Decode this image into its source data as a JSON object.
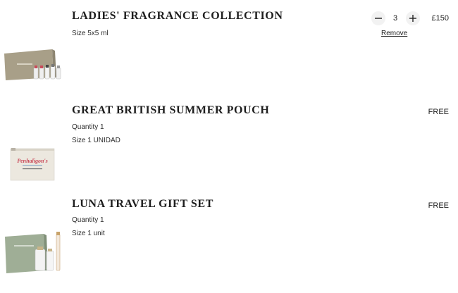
{
  "items": [
    {
      "title": "LADIES' FRAGRANCE COLLECTION",
      "size_label": "Size 5x5 ml",
      "quantity": "3",
      "price": "£150",
      "remove_label": "Remove",
      "image_icon": "fragrance-collection-box-image"
    },
    {
      "title": "GREAT BRITISH SUMMER POUCH",
      "quantity_label": "Quantity  1",
      "size_label": "Size 1 UNIDAD",
      "price": "FREE",
      "image_icon": "summer-pouch-image"
    },
    {
      "title": "LUNA TRAVEL GIFT SET",
      "quantity_label": "Quantity  1",
      "size_label": "Size 1 unit",
      "price": "FREE",
      "image_icon": "gift-set-box-image"
    }
  ],
  "colors": {
    "box_olive": "#a89f88",
    "box_green": "#9fae96",
    "pouch": "#ece8df",
    "button_bg": "#f2f2f2"
  }
}
